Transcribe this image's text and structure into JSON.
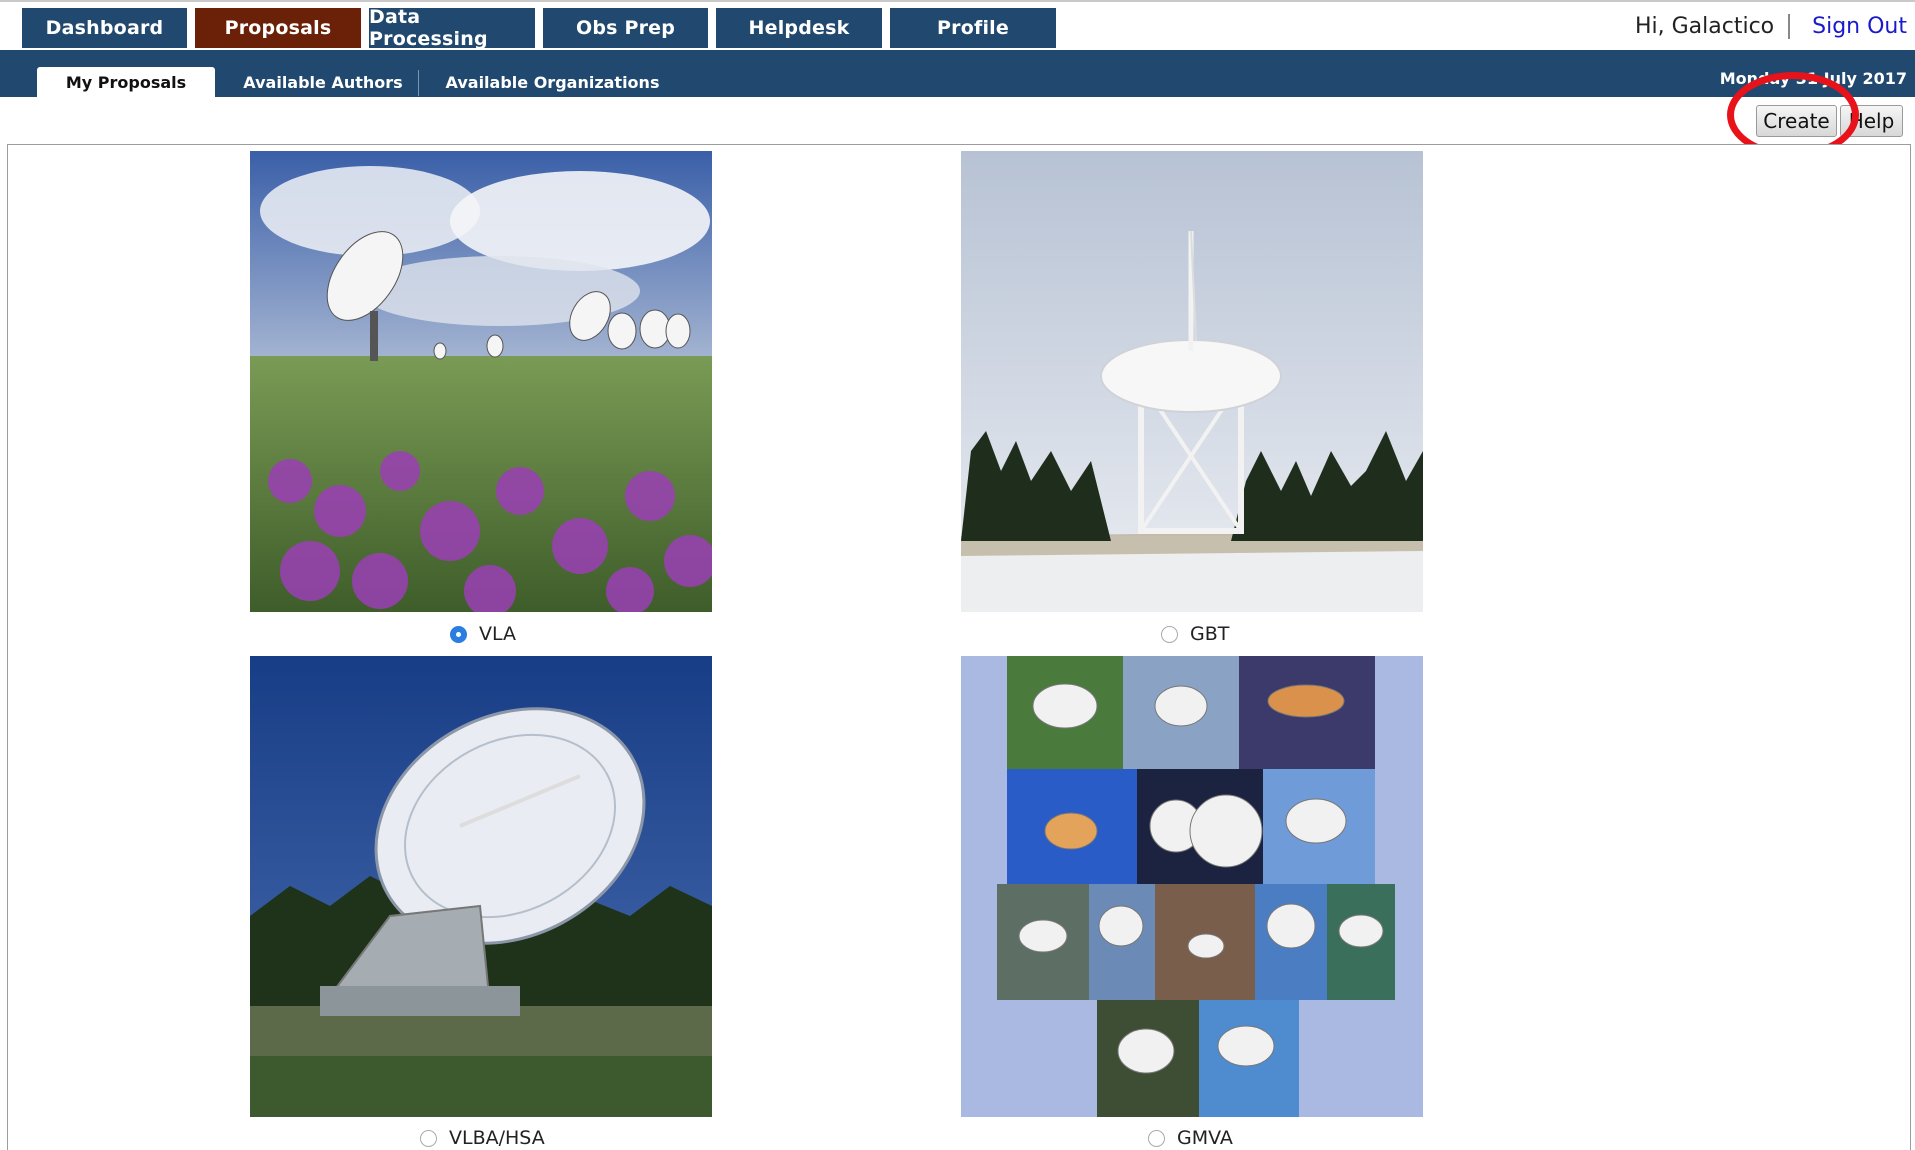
{
  "nav": {
    "tabs": [
      "Dashboard",
      "Proposals",
      "Data Processing",
      "Obs Prep",
      "Helpdesk",
      "Profile"
    ],
    "active_tab": "Proposals"
  },
  "user": {
    "greeting": "Hi, Galactico",
    "signout": "Sign Out"
  },
  "subnav": {
    "tabs": [
      "My Proposals",
      "Available Authors",
      "Available Organizations"
    ],
    "active_tab": "My Proposals",
    "date": "Monday 31 July 2017"
  },
  "toolbar": {
    "create_label": "Create",
    "help_label": "Help"
  },
  "facilities": [
    {
      "label": "VLA",
      "selected": true
    },
    {
      "label": "GBT",
      "selected": false
    },
    {
      "label": "VLBA/HSA",
      "selected": false
    },
    {
      "label": "GMVA",
      "selected": false
    }
  ]
}
